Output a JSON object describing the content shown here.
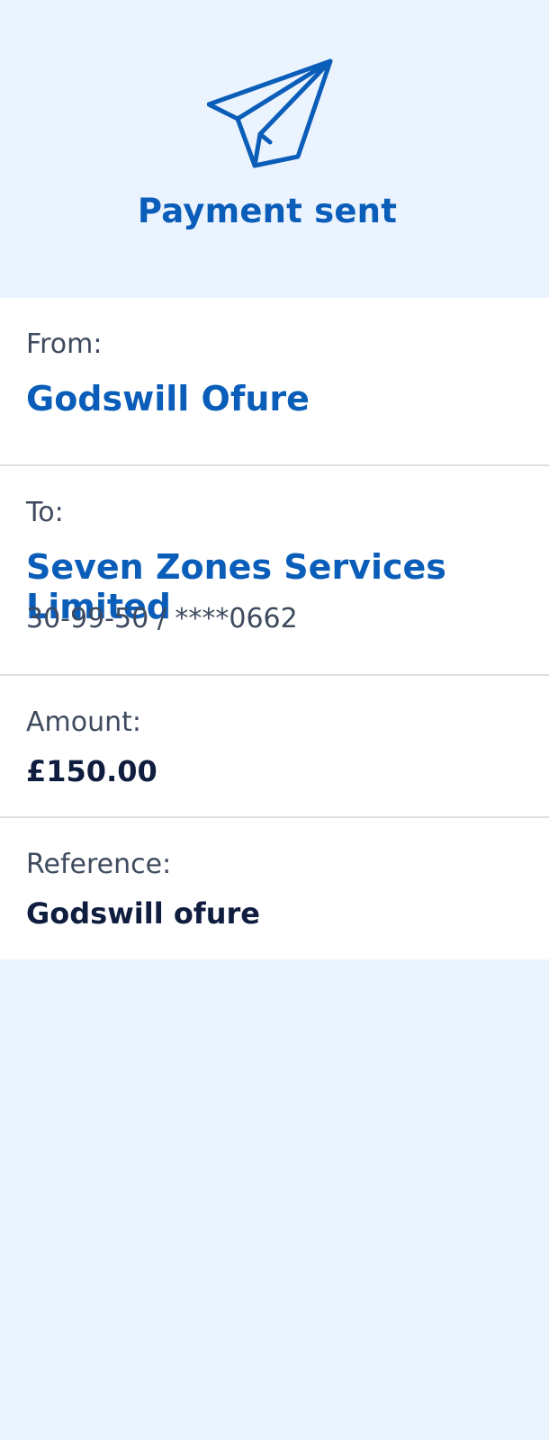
{
  "header": {
    "icon": "paper-plane-icon",
    "title": "Payment sent",
    "accent_color": "#0A5DB8",
    "background_color": "#EBF3FE"
  },
  "details": {
    "from": {
      "label": "From:",
      "name": "Godswill Ofure"
    },
    "to": {
      "label": "To:",
      "name": "Seven Zones Services Limited",
      "account": "30-99-50 / ****0662"
    },
    "amount": {
      "label": "Amount:",
      "value": "£150.00"
    },
    "reference": {
      "label": "Reference:",
      "value": "Godswill ofure"
    }
  }
}
